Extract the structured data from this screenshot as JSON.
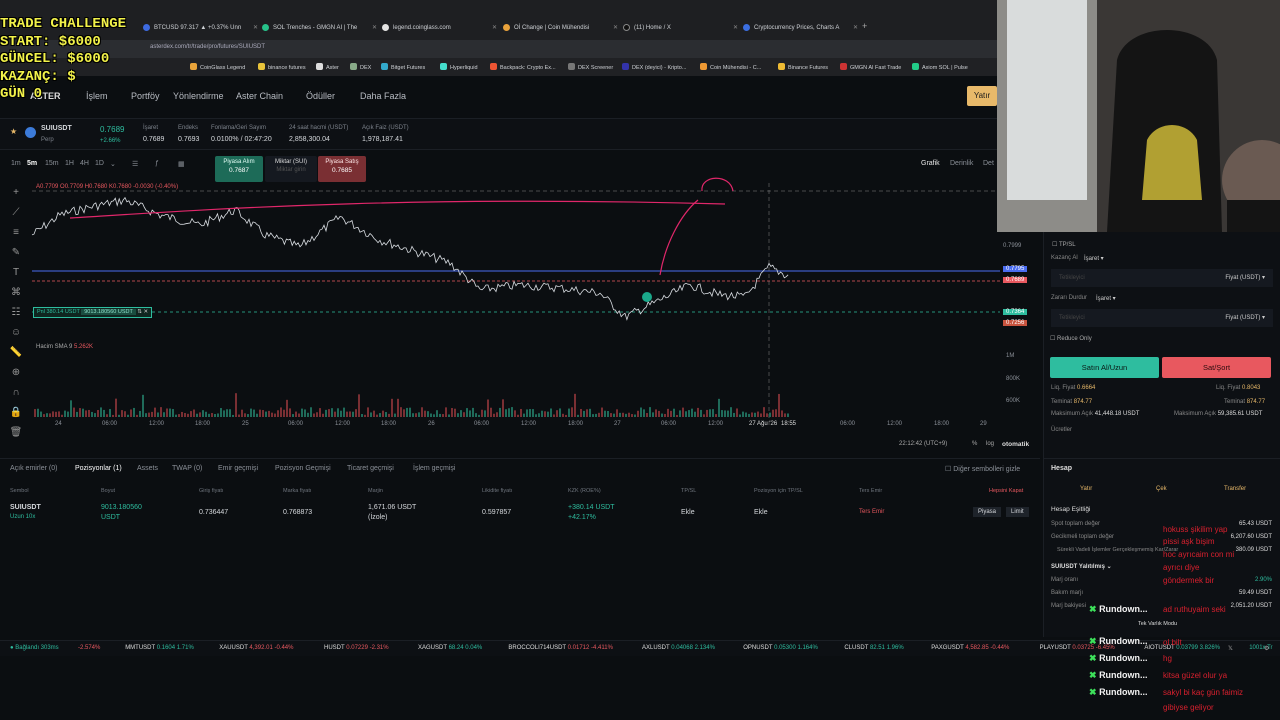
{
  "stream_overlay": {
    "lines": [
      "TRADE CHALLENGE",
      "START: $6000",
      "GÜNCEL: $6000",
      "KAZANÇ: $",
      "GÜN 0"
    ]
  },
  "browser": {
    "tabs": [
      {
        "label": "BTCUSD 97.317 ▲ +0.37% Unn",
        "color": "#3d6ae0"
      },
      {
        "label": "SOL Trenches - GMGN AI | The",
        "color": "#27c28a"
      },
      {
        "label": "legend.coinglass.com",
        "color": "#e4e4e4"
      },
      {
        "label": "Oİ Change | Coin Mühendisi",
        "color": "#e9a23b"
      },
      {
        "label": "(11) Home / X",
        "color": "#111111"
      },
      {
        "label": "Cryptocurrency Prices, Charts A",
        "color": "#3b6ee0"
      }
    ],
    "url": "asterdex.com/tr/trade/pro/futures/SUIUSDT",
    "bookmarks": [
      "CoinGlass Legend",
      "binance futures",
      "Aster",
      "DEX",
      "Bitget Futures",
      "Hyperliquid",
      "Backpack: Crypto Ex...",
      "DEX Screener",
      "DEX (deyici) - Kripto...",
      "Coin Mühendisi - C...",
      "Binance Futures",
      "GMGN AI Fast Trade",
      "Axiom SOL | Pulse"
    ]
  },
  "nav": {
    "logo": "ASTER",
    "items": [
      "İşlem",
      "Portföy",
      "Yönlendirme",
      "Aster Chain",
      "Ödüller",
      "Daha Fazla"
    ],
    "deposit": "Yatır"
  },
  "ticker": {
    "symbol": "SUIUSDT",
    "sub": "Perp",
    "price": "0.7689",
    "change": "+2.66%",
    "stats": [
      {
        "label": "İşaret",
        "value": "0.7689"
      },
      {
        "label": "Endeks",
        "value": "0.7693"
      },
      {
        "label": "Fonlama/Geri Sayım",
        "value": "0.0100% / 02:47:20"
      },
      {
        "label": "24 saat hacmi (USDT)",
        "value": "2,858,300.04"
      },
      {
        "label": "Açık Faiz (USDT)",
        "value": "1,978,187.41"
      }
    ]
  },
  "chart": {
    "timeframes": [
      "1m",
      "5m",
      "15m",
      "1H",
      "4H",
      "1D"
    ],
    "active_timeframe": "5m",
    "market_buy": {
      "label": "Piyasa Alım",
      "value": "0.7687"
    },
    "amount": {
      "label": "Miktar (SUI)",
      "value": "Miktar girin"
    },
    "market_sell": {
      "label": "Piyasa Satış",
      "value": "0.7685"
    },
    "view_tabs": [
      "Grafik",
      "Derinlik",
      "Det"
    ],
    "ohlc": "A0.7709 O0.7709 H0.7680 K0.7680 -0.0030 (-0.40%)",
    "volume_label": "Hacim SMA 9",
    "volume_value": "5.262K",
    "position_tag": "Pnl 380.14 USDT",
    "position_size": "9013.180560 USDT",
    "y_ticks": [
      "0.7999",
      "0.7795",
      "0.7689",
      "0.7364",
      "0.7256",
      "1M",
      "800K",
      "600K"
    ],
    "x_ticks": [
      "24",
      "06:00",
      "12:00",
      "18:00",
      "25",
      "06:00",
      "12:00",
      "18:00",
      "26",
      "06:00",
      "12:00",
      "18:00",
      "27",
      "06:00",
      "12:00",
      "27 Ağu '26",
      "18:55",
      "06:00",
      "12:00",
      "18:00",
      "29"
    ],
    "clock": "22:12:42 (UTC+9)",
    "footer": [
      "%",
      "log",
      "otomatik"
    ]
  },
  "positions": {
    "tabs": [
      "Açık emirler (0)",
      "Pozisyonlar (1)",
      "Assets",
      "TWAP (0)",
      "Emir geçmişi",
      "Pozisyon Geçmişi",
      "Ticaret geçmişi",
      "İşlem geçmişi"
    ],
    "hide_others": "Diğer sembolleri gizle",
    "columns": [
      "Sembol",
      "Boyut",
      "Giriş fiyatı",
      "Marka fiyatı",
      "Marjin",
      "Likidite fiyatı",
      "KZK (ROE%)",
      "TP/SL",
      "Pozisyon için TP/SL",
      "Ters Emir",
      "Hepsini Kapat"
    ],
    "row": {
      "symbol": "SUIUSDT",
      "sub": "Uzun 10x",
      "size": "9013.180560",
      "size_unit": "USDT",
      "entry": "0.736447",
      "mark": "0.768873",
      "margin": "1,671.06 USDT",
      "margin_mode": "(İzole)",
      "liq": "0.597857",
      "pnl": "+380.14 USDT",
      "roe": "+42.17%",
      "tpsl": "Ekle",
      "pos_tpsl": "Ekle",
      "reverse": "Ters Emir",
      "market": "Piyasa",
      "limit": "Limit"
    }
  },
  "order_panel": {
    "tpsl": "TP/SL",
    "tp_label": "Kazanç Al",
    "tp_type": "İşaret",
    "tp_placeholder": "Tetikleyici",
    "price_label": "Fiyat (USDT)",
    "sl_label": "Zararı Durdur",
    "sl_type": "İşaret",
    "sl_placeholder": "Tetikleyici",
    "reduce_only": "Reduce Only",
    "buy": "Satın Al/Uzun",
    "sell": "Sat/Şort",
    "liq_buy_label": "Liq. Fiyat",
    "liq_buy": "0.6664",
    "liq_sell_label": "Liq. Fiyat",
    "liq_sell": "0.8043",
    "margin_buy_label": "Teminat",
    "margin_buy": "874.77",
    "margin_sell_label": "Teminat",
    "margin_sell": "874.77",
    "max_buy_label": "Maksimum Açık",
    "max_buy": "41,448.18 USDT",
    "max_sell_label": "Maksimum Açık",
    "max_sell": "59,385.61 USDT",
    "fees": "Ücretler"
  },
  "account": {
    "title": "Hesap",
    "actions": [
      "Yatır",
      "Çek",
      "Transfer"
    ],
    "equity_title": "Hesap Eşitliği",
    "rows": [
      {
        "label": "Spot toplam değer",
        "value": "65.43 USDT"
      },
      {
        "label": "Gecikmeli toplam değer",
        "value": "6,207.60 USDT"
      },
      {
        "label": "Sürekli Vadeli İşlemler Gerçekleşmemiş Kar/Zarar",
        "value": "380.09 USDT"
      }
    ],
    "margin_title": "SUIUSDT Yalıtılmış",
    "margin_rows": [
      {
        "label": "Marj oranı",
        "value": "2.90%"
      },
      {
        "label": "Bakım marjı",
        "value": "59.49 USDT"
      },
      {
        "label": "Marj bakiyesi",
        "value": "2,051.20 USDT"
      }
    ],
    "mode": "Tek Varlık Modu"
  },
  "bottom_ticker": {
    "status": "Bağlandı 303ms",
    "items": [
      {
        "sym": "",
        "val": "-2.574%",
        "neg": true
      },
      {
        "sym": "MMTUSDT",
        "val": "0.1604  1.71%",
        "neg": false
      },
      {
        "sym": "XAUUSDT",
        "val": "4,392.01  -0.44%",
        "neg": true
      },
      {
        "sym": "HUSDT",
        "val": "0.07229  -2.31%",
        "neg": true
      },
      {
        "sym": "XAGUSDT",
        "val": "68.24  0.04%",
        "neg": false
      },
      {
        "sym": "BROCCOLI714USDT",
        "val": "0.01712  -4.411%",
        "neg": true
      },
      {
        "sym": "AXLUSDT",
        "val": "0.04068  2.134%",
        "neg": false
      },
      {
        "sym": "OPNUSDT",
        "val": "0.05300  1.164%",
        "neg": false
      },
      {
        "sym": "CLUSDT",
        "val": "82.51  1.96%",
        "neg": false
      },
      {
        "sym": "PAXGUSDT",
        "val": "4,582.85  -0.44%",
        "neg": true
      },
      {
        "sym": "PLAYUSDT",
        "val": "0.03725  -6.45%",
        "neg": true
      },
      {
        "sym": "AIOTUSDT",
        "val": "0.03799  3.826%",
        "neg": false
      },
      {
        "sym": "",
        "val": "1001x Tr",
        "neg": false
      }
    ]
  },
  "chat": {
    "name": "Rundown...",
    "messages": [
      "hokuss şikilim yap",
      "pissi aşk bişim",
      "hoc ayrıcaim con mi",
      "ayrıcı diye",
      "göndermek bir",
      "ad ruthuyaim seki",
      "ol bilt",
      "hg",
      "kitsa güzel olur ya",
      "sakyl bi kaç gün faimiz",
      "gibiyse geliyor"
    ]
  },
  "colors": {
    "green": "#2ebd9f",
    "red": "#e8585f",
    "accent": "#e8b96a",
    "overlay_yellow": "#f2f24a",
    "pink_line": "#e0276a",
    "blue_line": "#4a6cf0"
  }
}
